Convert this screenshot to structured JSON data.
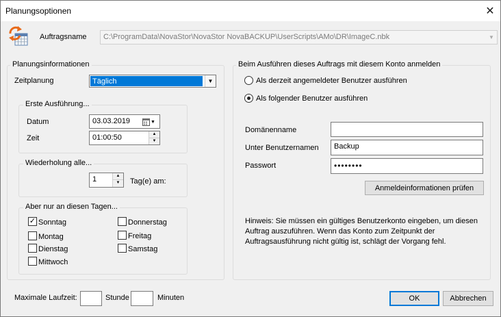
{
  "window": {
    "title": "Planungsoptionen",
    "close_glyph": "✕"
  },
  "job": {
    "label": "Auftragsname",
    "path": "C:\\ProgramData\\NovaStor\\NovaStor NovaBACKUP\\UserScripts\\AMo\\DR\\ImageC.nbk"
  },
  "planning": {
    "legend": "Planungsinformationen",
    "schedule_label": "Zeitplanung",
    "schedule_value": "Täglich",
    "first_run": {
      "legend": "Erste Ausführung...",
      "date_label": "Datum",
      "date_value": "03.03.2019",
      "time_label": "Zeit",
      "time_value": "01:00:50"
    },
    "repeat": {
      "legend": "Wiederholung alle...",
      "value": "1",
      "unit_label": "Tag(e) am:"
    },
    "days": {
      "legend": "Aber nur an diesen Tagen...",
      "items": [
        {
          "label": "Sonntag",
          "checked": true,
          "mark": "✓"
        },
        {
          "label": "Montag",
          "checked": false,
          "mark": ""
        },
        {
          "label": "Dienstag",
          "checked": false,
          "mark": ""
        },
        {
          "label": "Mittwoch",
          "checked": false,
          "mark": ""
        },
        {
          "label": "Donnerstag",
          "checked": false,
          "mark": ""
        },
        {
          "label": "Freitag",
          "checked": false,
          "mark": ""
        },
        {
          "label": "Samstag",
          "checked": false,
          "mark": ""
        }
      ]
    }
  },
  "account": {
    "legend": "Beim Ausführen dieses Auftrags mit diesem Konto anmelden",
    "radio_current": "Als derzeit angemeldeter Benutzer ausführen",
    "radio_following": "Als folgender Benutzer ausführen",
    "selected": "following",
    "domain_label": "Domänenname",
    "domain_value": "",
    "user_label": "Unter Benutzernamen",
    "user_value": "Backup",
    "password_label": "Passwort",
    "password_value": "••••••••",
    "verify_button": "Anmeldeinformationen prüfen",
    "hint": "Hinweis: Sie müssen ein gültiges Benutzerkonto eingeben, um diesen Auftrag auszuführen. Wenn das Konto zum Zeitpunkt der Auftragsausführung nicht gültig ist, schlägt der Vorgang fehl."
  },
  "footer": {
    "max_runtime_label": "Maximale Laufzeit:",
    "hours_value": "",
    "hours_label": "Stunde",
    "minutes_value": "",
    "minutes_label": "Minuten",
    "ok_button": "OK",
    "cancel_button": "Abbrechen"
  },
  "icons": {
    "close": "close-icon",
    "schedule": "schedule-calendar-icon",
    "combo_arrow": "▼",
    "calendar": "calendar-icon",
    "spin_up": "▲",
    "spin_down": "▼"
  }
}
